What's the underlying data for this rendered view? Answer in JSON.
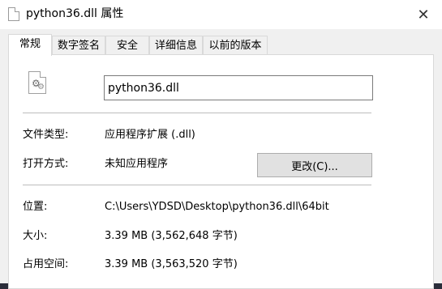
{
  "window": {
    "title": "python36.dll 属性",
    "close_glyph": "✕"
  },
  "tabs": [
    {
      "label": "常规",
      "active": true
    },
    {
      "label": "数字签名",
      "active": false
    },
    {
      "label": "安全",
      "active": false
    },
    {
      "label": "详细信息",
      "active": false
    },
    {
      "label": "以前的版本",
      "active": false
    }
  ],
  "general": {
    "file_name": "python36.dll",
    "file_type_label": "文件类型:",
    "file_type_value": "应用程序扩展 (.dll)",
    "open_with_label": "打开方式:",
    "open_with_value": "未知应用程序",
    "change_button": "更改(C)...",
    "location_label": "位置:",
    "location_value": "C:\\Users\\YDSD\\Desktop\\python36.dll\\64bit",
    "size_label": "大小:",
    "size_value": "3.39 MB (3,562,648 字节)",
    "disk_size_label": "占用空间:",
    "disk_size_value": "3.39 MB (3,563,520 字节)"
  },
  "icons": {
    "file": "dll-file-icon",
    "title": "dll-file-icon",
    "close": "close-icon"
  }
}
